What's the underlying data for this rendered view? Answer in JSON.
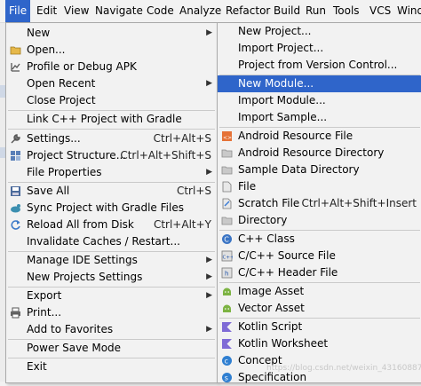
{
  "menubar": {
    "file": "File",
    "edit": "Edit",
    "view": "View",
    "navigate": "Navigate",
    "code": "Code",
    "analyze": "Analyze",
    "refactor": "Refactor",
    "build": "Build",
    "run": "Run",
    "tools": "Tools",
    "vcs": "VCS",
    "window": "Wind"
  },
  "file_menu": {
    "new": "New",
    "open": "Open...",
    "profile_debug": "Profile or Debug APK",
    "open_recent": "Open Recent",
    "close_project": "Close Project",
    "link_cpp": "Link C++ Project with Gradle",
    "settings": "Settings...",
    "settings_sc": "Ctrl+Alt+S",
    "project_structure": "Project Structure...",
    "project_structure_sc": "Ctrl+Alt+Shift+S",
    "file_properties": "File Properties",
    "save_all": "Save All",
    "save_all_sc": "Ctrl+S",
    "sync_gradle": "Sync Project with Gradle Files",
    "reload_disk": "Reload All from Disk",
    "reload_disk_sc": "Ctrl+Alt+Y",
    "invalidate": "Invalidate Caches / Restart...",
    "manage_ide": "Manage IDE Settings",
    "new_projects_settings": "New Projects Settings",
    "export": "Export",
    "print": "Print...",
    "add_favorites": "Add to Favorites",
    "power_save": "Power Save Mode",
    "exit": "Exit"
  },
  "new_menu": {
    "new_project": "New Project...",
    "import_project": "Import Project...",
    "project_from_vc": "Project from Version Control...",
    "new_module": "New Module...",
    "import_module": "Import Module...",
    "import_sample": "Import Sample...",
    "android_resource_file": "Android Resource File",
    "android_resource_dir": "Android Resource Directory",
    "sample_data_dir": "Sample Data Directory",
    "file": "File",
    "scratch_file": "Scratch File",
    "scratch_file_sc": "Ctrl+Alt+Shift+Insert",
    "directory": "Directory",
    "cpp_class": "C++ Class",
    "cpp_source": "C/C++ Source File",
    "cpp_header": "C/C++ Header File",
    "image_asset": "Image Asset",
    "vector_asset": "Vector Asset",
    "kotlin_script": "Kotlin Script",
    "kotlin_worksheet": "Kotlin Worksheet",
    "concept": "Concept",
    "specification": "Specification"
  },
  "watermark": "https://blog.csdn.net/weixin_43160887",
  "colors": {
    "highlight": "#2f65ca",
    "menu_bg": "#f2f2f2",
    "separator": "#cacaca"
  }
}
